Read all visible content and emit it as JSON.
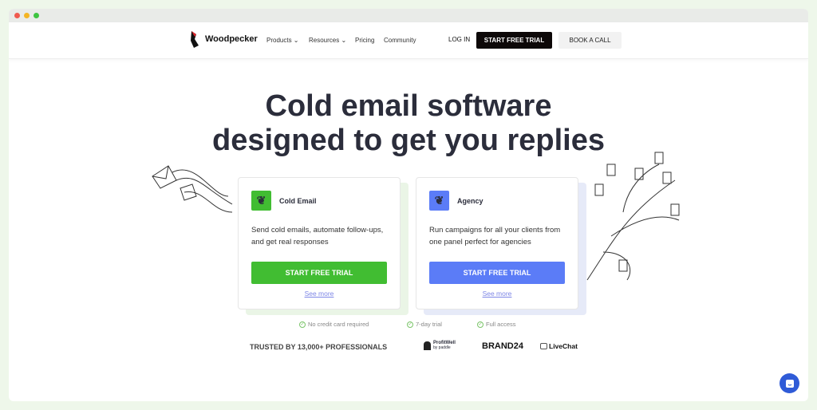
{
  "nav": {
    "brand": "Woodpecker",
    "links": [
      "Products",
      "Resources",
      "Pricing",
      "Community"
    ],
    "login": "LOG IN",
    "start_trial": "START FREE TRIAL",
    "book_call": "BOOK A CALL"
  },
  "hero": {
    "line1": "Cold email software",
    "line2": "designed to get you replies"
  },
  "cards": [
    {
      "title": "Cold Email",
      "desc": "Send cold emails, automate follow-ups, and get real responses",
      "button": "START FREE TRIAL",
      "link": "See more",
      "color": "#41bd32"
    },
    {
      "title": "Agency",
      "desc": "Run campaigns for all your clients from one panel perfect for agencies",
      "button": "START FREE TRIAL",
      "link": "See more",
      "color": "#5b7cf7"
    }
  ],
  "checks": [
    "No credit card required",
    "7-day trial",
    "Full access"
  ],
  "trusted": "TRUSTED BY 13,000+ PROFESSIONALS",
  "logos": {
    "profitwell": "ProfitWell",
    "profitwell_sub": "by paddle",
    "brand24": "BRAND24",
    "livechat": "LiveChat"
  }
}
